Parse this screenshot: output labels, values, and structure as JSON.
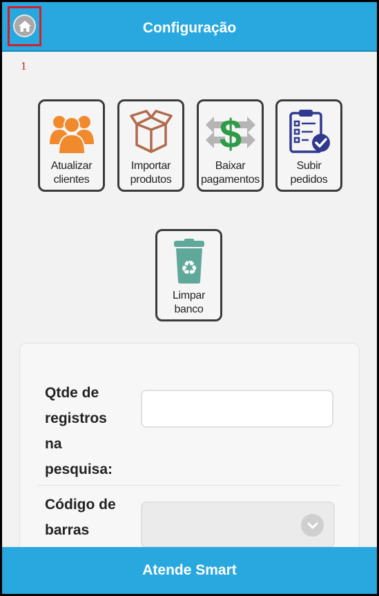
{
  "header": {
    "title": "Configuração"
  },
  "annotation": {
    "marker": "1"
  },
  "tiles": [
    {
      "label": "Atualizar\nclientes",
      "icon": "people-icon"
    },
    {
      "label": "Importar\nprodutos",
      "icon": "box-icon"
    },
    {
      "label": "Baixar\npagamentos",
      "icon": "dollar-arrows-icon"
    },
    {
      "label": "Subir\npedidos",
      "icon": "clipboard-check-icon"
    },
    {
      "label": "Limpar\nbanco",
      "icon": "recycle-bin-icon"
    }
  ],
  "form": {
    "records_label": "Qtde de\nregistros\nna\npesquisa:",
    "records_value": "",
    "barcode_label": "Código de\nbarras",
    "barcode_value": ""
  },
  "footer": {
    "title": "Atende Smart"
  },
  "colors": {
    "header": "#29a8e0",
    "annotation": "#d0202a",
    "people": "#f08a2c",
    "box": "#b06a4c",
    "dollar": "#2f9a47",
    "clipboard": "#2f3a8f",
    "bin": "#5fa89a"
  }
}
